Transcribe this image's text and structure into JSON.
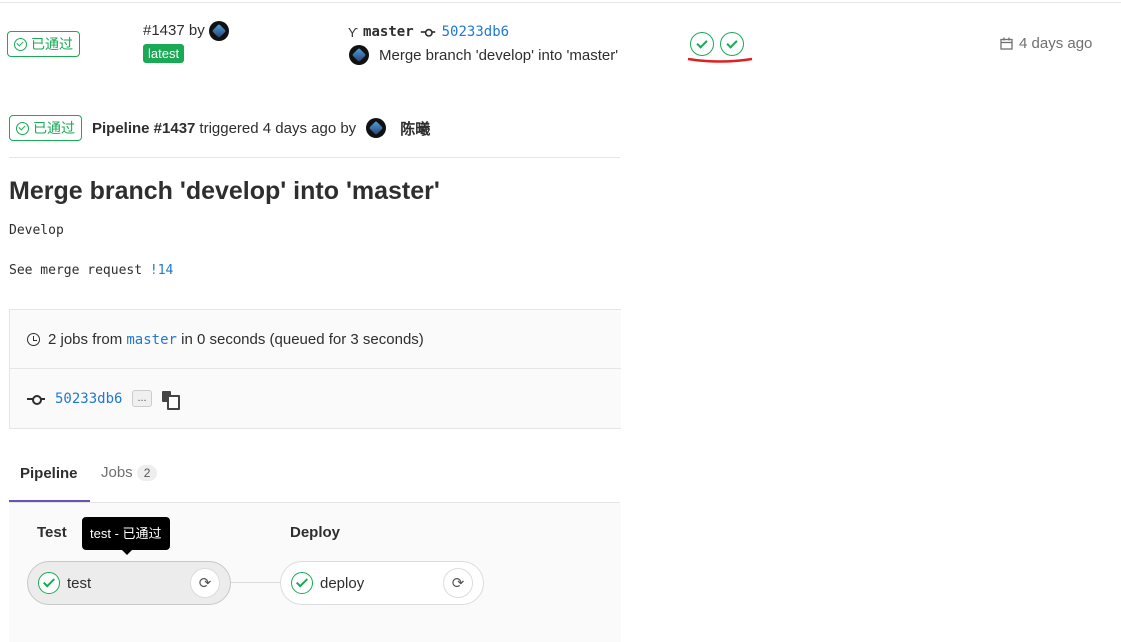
{
  "list_row": {
    "status": "已通过",
    "pipeline_id": "#1437",
    "by": "by",
    "latest_badge": "latest",
    "branch": "master",
    "commit_sha": "50233db6",
    "commit_message": "Merge branch 'develop' into 'master'",
    "time": "4 days ago"
  },
  "header": {
    "status": "已通过",
    "pipeline_label": "Pipeline #1437",
    "triggered_text": "triggered 4 days ago by",
    "user": "陈曦"
  },
  "commit": {
    "title": "Merge branch 'develop' into 'master'",
    "body_line1": "Develop",
    "body_line2_prefix": "See merge request",
    "merge_request_ref": "!14"
  },
  "info": {
    "jobs_prefix": "2 jobs from",
    "branch": "master",
    "jobs_suffix": "in 0 seconds (queued for 3 seconds)",
    "commit_sha": "50233db6",
    "ellipsis": "..."
  },
  "tabs": {
    "pipeline": "Pipeline",
    "jobs": "Jobs",
    "jobs_count": "2"
  },
  "graph": {
    "stage_test": "Test",
    "stage_deploy": "Deploy",
    "job_test": "test",
    "job_deploy": "deploy",
    "tooltip": "test - 已通过"
  },
  "colors": {
    "success": "#1aaa55",
    "link": "#1f78d1",
    "annotation": "#e02020"
  },
  "icons": {
    "status": "check-circle-icon",
    "branch": "fork-icon",
    "commit": "commit-icon",
    "calendar": "calendar-icon",
    "clock": "clock-icon",
    "copy": "copy-icon",
    "retry": "retry-icon"
  }
}
